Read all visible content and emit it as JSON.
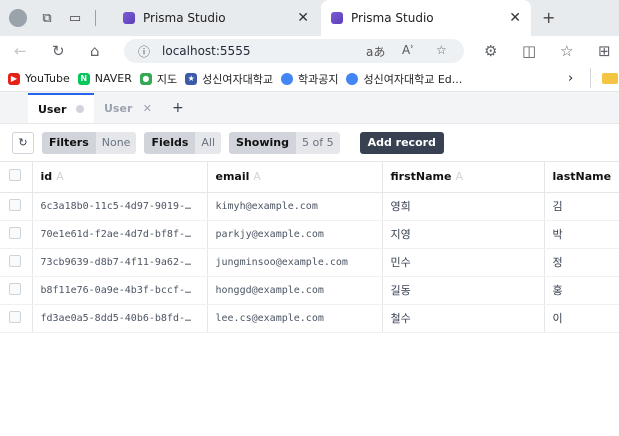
{
  "browser": {
    "tabs": [
      {
        "title": "Prisma Studio",
        "close": "✕"
      },
      {
        "title": "Prisma Studio",
        "close": "✕"
      }
    ],
    "new_tab": "+",
    "address": "localhost:5555",
    "addr_icons": {
      "reader": "aあ",
      "voice": "Aʾ",
      "fav": "☆"
    },
    "bookmarks": [
      {
        "label": "YouTube",
        "icon": "youtube-icon",
        "color": "#e62117"
      },
      {
        "label": "NAVER",
        "icon": "naver-icon",
        "color": "#03c75a"
      },
      {
        "label": "지도",
        "icon": "maps-icon",
        "color": "#34a853"
      },
      {
        "label": "성신여자대학교",
        "icon": "school-icon",
        "color": "#3b5ba9"
      },
      {
        "label": "학과공지",
        "icon": "globe-icon",
        "color": "#4285f4"
      },
      {
        "label": "성신여자대학교 Ed...",
        "icon": "globe-icon",
        "color": "#4285f4"
      }
    ],
    "more": "›"
  },
  "studio": {
    "tabs": [
      {
        "label": "User"
      },
      {
        "label": "User",
        "close": "✕"
      }
    ],
    "plus": "+",
    "toolbar": {
      "filters_label": "Filters",
      "filters_value": "None",
      "fields_label": "Fields",
      "fields_value": "All",
      "showing_label": "Showing",
      "showing_value": "5 of 5",
      "add_record": "Add record"
    },
    "columns": [
      {
        "name": "id",
        "type": "A"
      },
      {
        "name": "email",
        "type": "A"
      },
      {
        "name": "firstName",
        "type": "A"
      },
      {
        "name": "lastName",
        "type": ""
      }
    ],
    "rows": [
      {
        "id": "6c3a18b0-11c5-4d97-9019-…",
        "email": "kimyh@example.com",
        "firstName": "영희",
        "lastName": "김"
      },
      {
        "id": "70e1e61d-f2ae-4d7d-bf8f-…",
        "email": "parkjy@example.com",
        "firstName": "지영",
        "lastName": "박"
      },
      {
        "id": "73cb9639-d8b7-4f11-9a62-…",
        "email": "jungminsoo@example.com",
        "firstName": "민수",
        "lastName": "정"
      },
      {
        "id": "b8f11e76-0a9e-4b3f-bccf-…",
        "email": "honggd@example.com",
        "firstName": "길동",
        "lastName": "홍"
      },
      {
        "id": "fd3ae0a5-8dd5-40b6-b8fd-…",
        "email": "lee.cs@example.com",
        "firstName": "철수",
        "lastName": "이"
      }
    ]
  }
}
